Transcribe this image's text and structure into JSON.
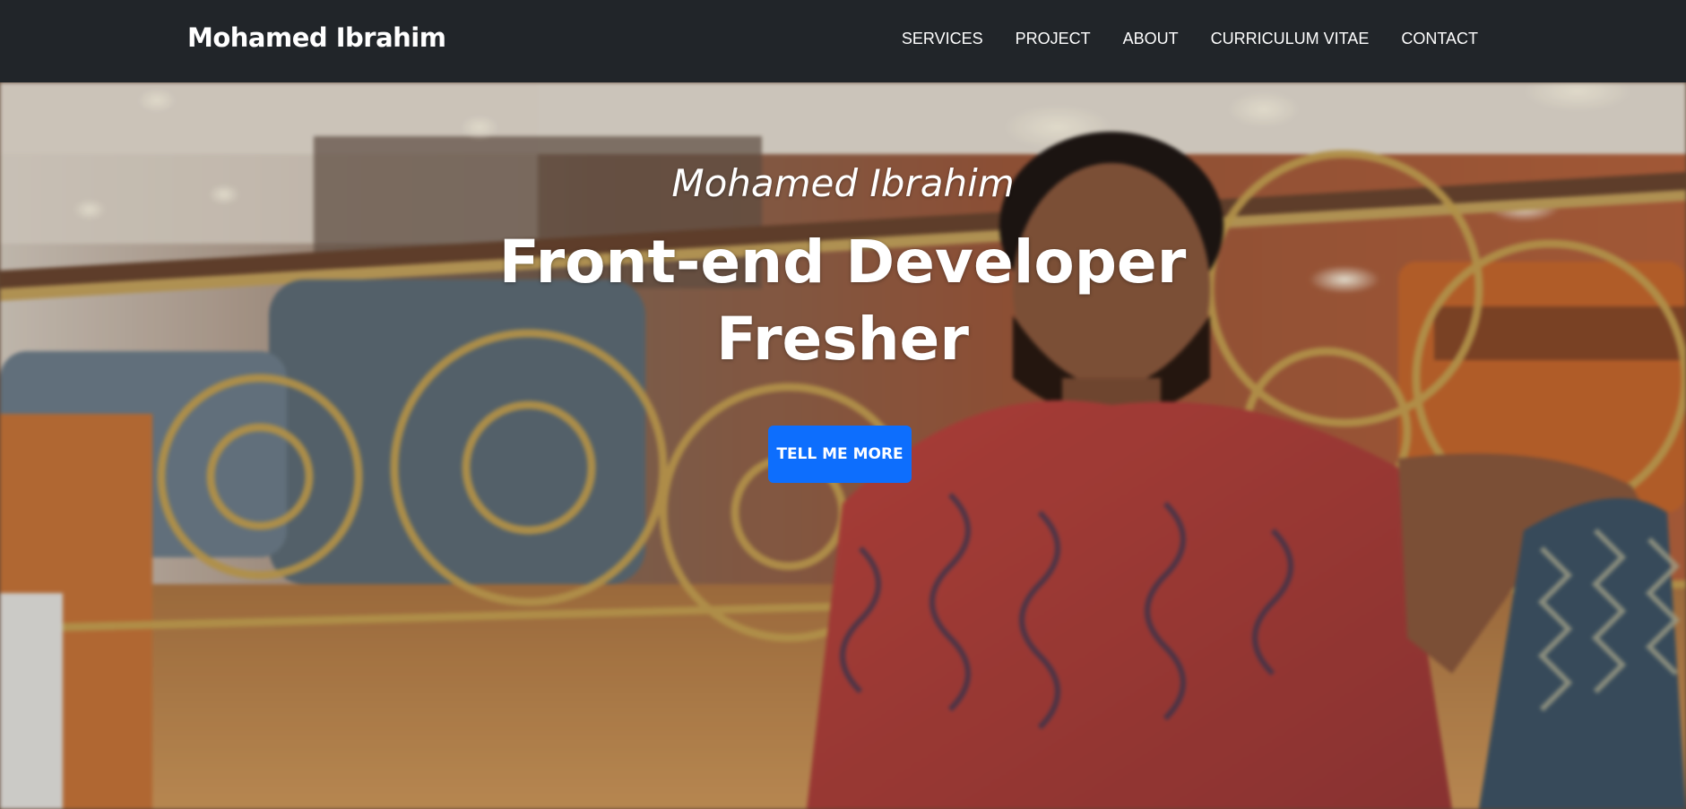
{
  "navbar": {
    "brand": "Mohamed Ibrahim",
    "links": [
      "SERVICES",
      "PROJECT",
      "ABOUT",
      "CURRICULUM VITAE",
      "CONTACT"
    ]
  },
  "hero": {
    "subheading": "Mohamed Ibrahim",
    "heading": "Front-end Developer Fresher",
    "button_label": "TELL ME MORE"
  },
  "colors": {
    "navbar_bg": "#212529",
    "button_bg": "#0d6efd",
    "text": "#ffffff"
  }
}
